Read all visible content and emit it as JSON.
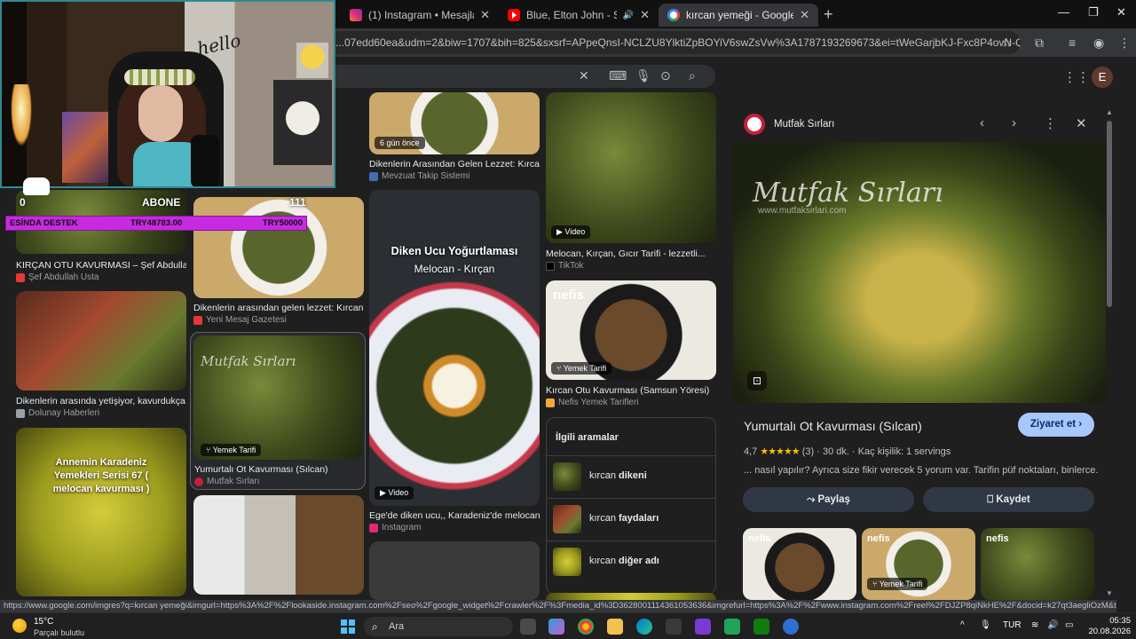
{
  "tabs": [
    {
      "title": "(1) Instagram • Mesajlar",
      "icon": "instagram-icon"
    },
    {
      "title": "Blue, Elton John - Sorry See",
      "icon": "youtube-icon"
    },
    {
      "title": "kırcan yemeği - Google'da Ara",
      "icon": "google-icon"
    }
  ],
  "url": "...07edd60ea&udm=2&biw=1707&bih=825&sxsrf=APpeQnsI-NCLZU8YlktiZpBOYiV6swZsVw%3A1787193269673&ei=tWeGarjbKJ-Fxc8P4ovN-QE&oq=kırcan...",
  "account_initial": "E",
  "results": [
    {
      "title": "KIRÇAN OTU KAVURMASI – Şef Abdullah...",
      "source": "Şef Abdullah Usta",
      "src_color": "#e53935"
    },
    {
      "title": "Dikenlerin arasında yetişiyor, kavurdukça...",
      "source": "Dolunay Haberleri",
      "src_color": "#9aa0a6"
    },
    {
      "title": "Annemin Karadeniz Yemekleri Serisi 67 ( melocan kavurması )",
      "source": "",
      "src_color": ""
    },
    {
      "title": "Dikenlerin arasından gelen lezzet: Kırcan",
      "source": "Yeni Mesaj Gazetesi",
      "src_color": "#e53935"
    },
    {
      "title": "Yumurtalı Ot Kavurması (Sılcan)",
      "source": "Mutfak Sırları",
      "badge": "Yemek Tarifi",
      "src_color": "#c81e3a"
    },
    {
      "title": "Dikenlerin Arasından Gelen Lezzet: Kırcan...",
      "source": "Mevzuat Takip Sistemi",
      "badge": "6 gün önce",
      "src_color": "#3f6fb6"
    },
    {
      "title": "Ege'de diken ucu,, Karadeniz'de melocan...",
      "source": "Instagram",
      "badge": "Video",
      "overlay1": "Diken Ucu Yoğurtlaması",
      "overlay2": "Melocan - Kırçan",
      "src_color": "#dd2a7b"
    },
    {
      "title": "Melocan, Kırçan, Gıcır Tarifi - lezzetli...",
      "source": "TikTok",
      "badge": "Video",
      "src_color": "#000000"
    },
    {
      "title": "Kırcan Otu Kavurması (Samsun Yöresi)",
      "source": "Nefis Yemek Tarifleri",
      "badge": "Yemek Tarifi",
      "src_color": "#f2a93b"
    }
  ],
  "related": {
    "heading": "İlgili aramalar",
    "items": [
      {
        "prefix": "kırcan ",
        "bold": "dikeni"
      },
      {
        "prefix": "kırcan ",
        "bold": "faydaları"
      },
      {
        "prefix": "kırcan ",
        "bold": "diğer adı"
      }
    ]
  },
  "panel": {
    "site": "Mutfak Sırları",
    "watermark": "Mutfak Sırları",
    "watermark_url": "www.mutfaksirlari.com",
    "title": "Yumurtalı Ot Kavurması (Sılcan)",
    "visit": "Ziyaret et",
    "rating": "4,7",
    "stars": "★★★★★",
    "reviews": "(3)",
    "time": "30 dk.",
    "servings": "Kaç kişilik: 1 servings",
    "snippet": "... nasıl yapılır? Ayrıca size fikir verecek 5 yorum var. Tarifin püf noktaları, binlerce...",
    "share": "Paylaş",
    "save": "Kaydet",
    "thumb_badge": "Yemek Tarifi",
    "thumb_logo": "nefis"
  },
  "status_url": "https://www.google.com/imgres?q=kırcan yemeği&imgurl=https%3A%2F%2Flookaside.instagram.com%2Fseo%2Fgoogle_widget%2Fcrawler%2F%3Fmedia_id%3D3628001114361053636&imgrefurl=https%3A%2F%2Fwww.instagram.com%2Freel%2FDJZP8qiNkHE%2F&docid=k27qt3aegliOzM&tbnid=YM-Q-SKDZ...",
  "taskbar": {
    "temp": "15°C",
    "weather": "Parçalı bulutlu",
    "search": "Ara",
    "lang": "TUR",
    "time": "05:35",
    "date": "20.08.2026"
  },
  "stream": {
    "hello": "hello",
    "left_count": "0",
    "sub_label": "ABONE",
    "right_count": "111",
    "goal_label": "ESİNDA DESTEK",
    "goal_current": "TRY48783.00",
    "goal_target": "TRY50000",
    "goal_progress": 0.976
  },
  "colors": {
    "accent": "#a8c7fa",
    "goal_bar": "#c72ae0",
    "cam_border": "#2f8a92"
  }
}
